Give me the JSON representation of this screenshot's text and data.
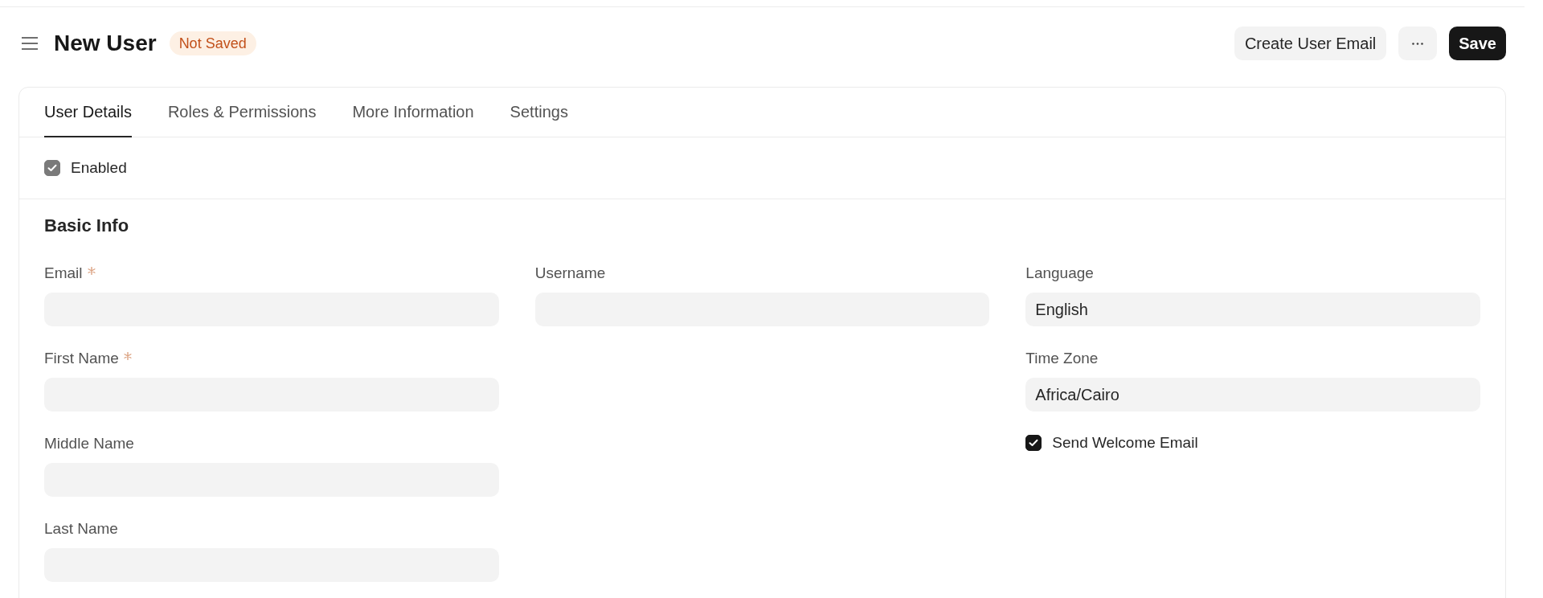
{
  "header": {
    "title": "New User",
    "status_badge": "Not Saved",
    "actions": [
      {
        "kind": "secondary",
        "label": "Create User Email"
      },
      {
        "kind": "menu"
      },
      {
        "kind": "primary",
        "label": "Save"
      }
    ]
  },
  "tabs": [
    {
      "label": "User Details",
      "selected": true
    },
    {
      "label": "Roles & Permissions",
      "selected": false
    },
    {
      "label": "More Information",
      "selected": false
    },
    {
      "label": "Settings",
      "selected": false
    }
  ],
  "enabled": {
    "label": "Enabled",
    "checked": true,
    "disabled": true
  },
  "section": {
    "title": "Basic Info",
    "columns": [
      {
        "fields": [
          {
            "kind": "input",
            "label": "Email",
            "required": true
          },
          {
            "kind": "input",
            "label": "First Name",
            "required": true
          },
          {
            "kind": "input",
            "label": "Middle Name",
            "required": false
          },
          {
            "kind": "input",
            "label": "Last Name",
            "required": false
          }
        ]
      },
      {
        "fields": [
          {
            "kind": "input",
            "label": "Username",
            "required": false
          }
        ]
      },
      {
        "fields": [
          {
            "kind": "input",
            "label": "Language",
            "required": false,
            "value": "English"
          },
          {
            "kind": "input",
            "label": "Time Zone",
            "required": false,
            "value": "Africa/Cairo"
          },
          {
            "kind": "checkbox",
            "label": "Send Welcome Email",
            "checked": true,
            "disabled": false
          }
        ]
      }
    ]
  }
}
